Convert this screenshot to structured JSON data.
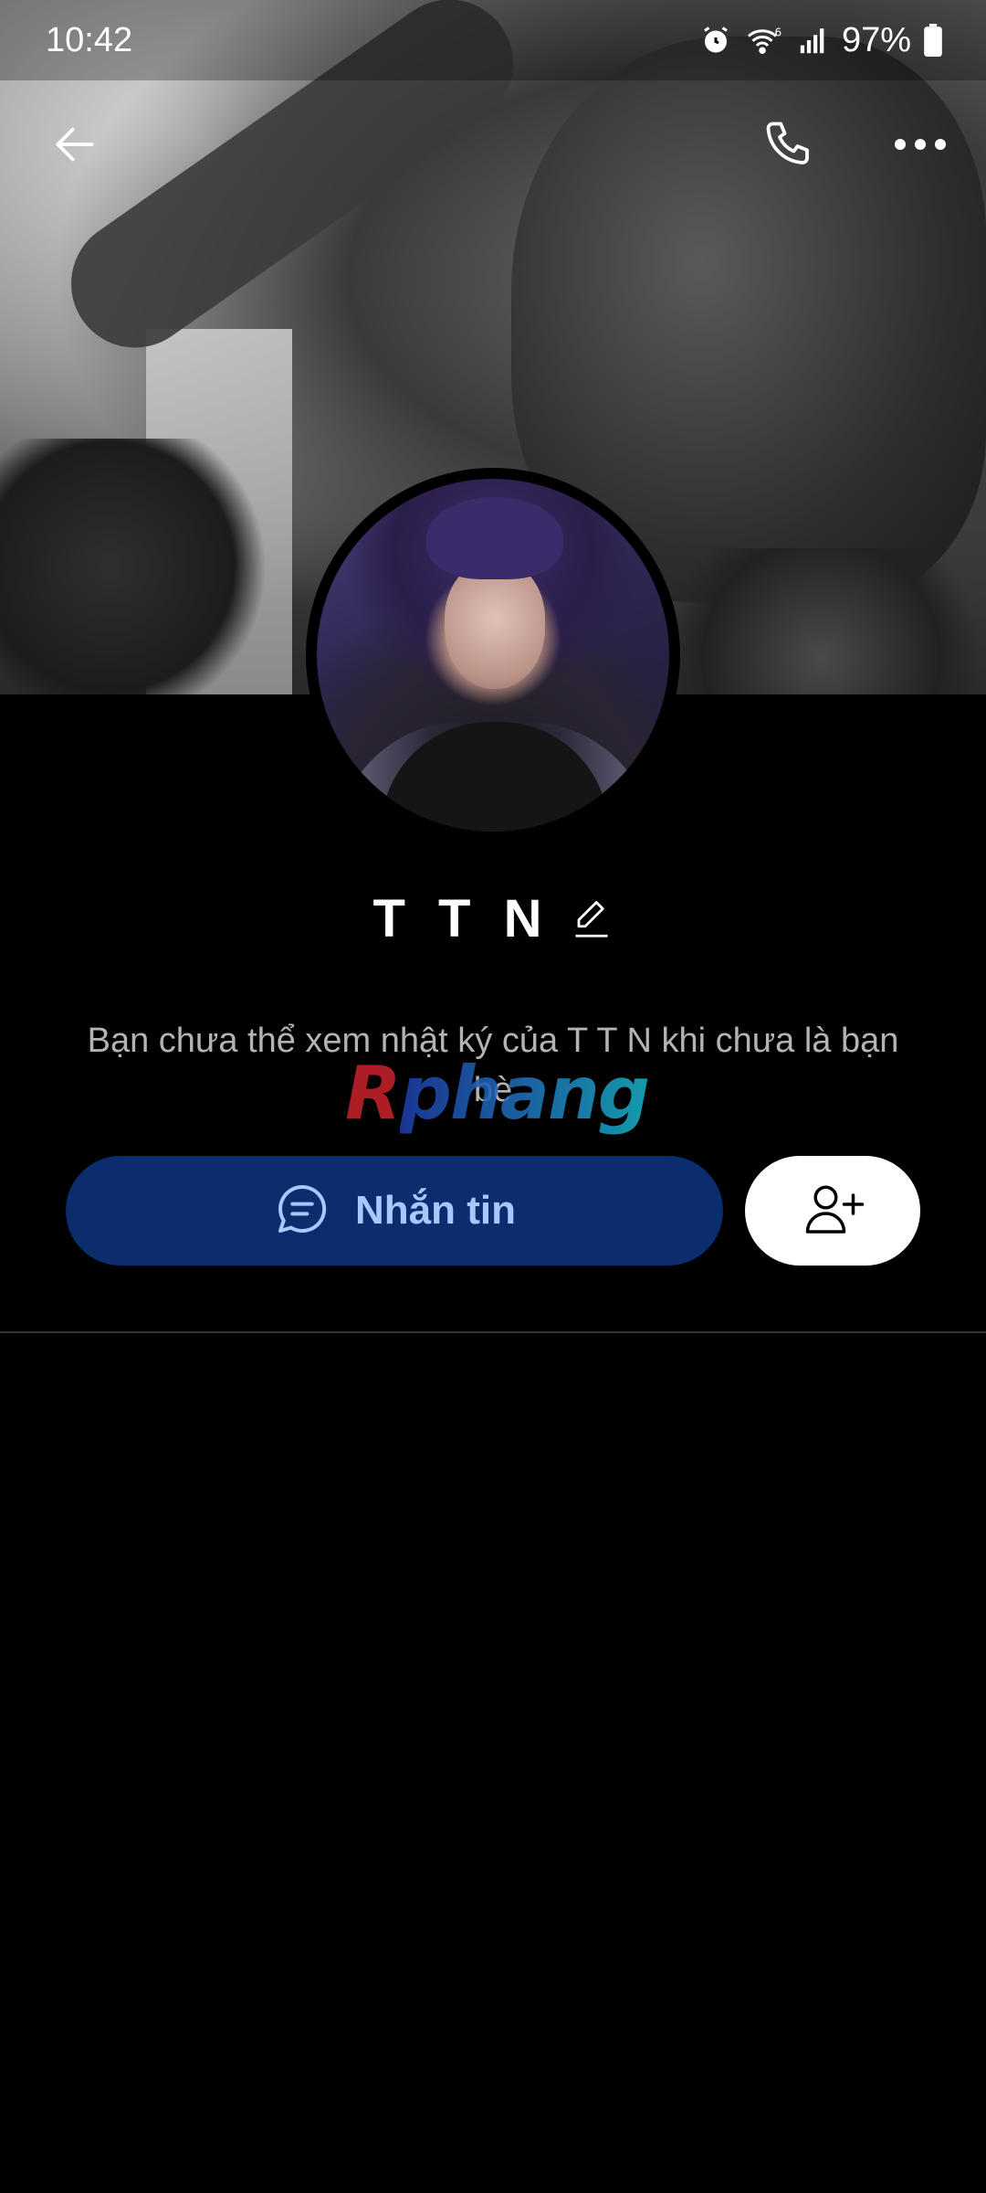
{
  "status_bar": {
    "time": "10:42",
    "battery_percent": "97%",
    "icons": [
      "alarm-icon",
      "wifi-6-icon",
      "signal-icon",
      "battery-icon"
    ]
  },
  "toolbar": {
    "icons": [
      "back-arrow-icon",
      "phone-icon",
      "more-options-icon"
    ]
  },
  "profile": {
    "name": "T T N",
    "edit_icon": "pencil-icon"
  },
  "info": {
    "message": "Bạn chưa thể xem nhật ký của T T N khi chưa là bạn bè"
  },
  "watermark": {
    "first_letter": "R",
    "rest": "phang"
  },
  "actions": {
    "message_label": "Nhắn tin",
    "message_icon": "chat-bubble-icon",
    "add_friend_icon": "add-user-icon"
  },
  "colors": {
    "background": "#000000",
    "message_button_bg": "#0a2d6e",
    "message_button_text": "#a9c8ff",
    "add_button_bg": "#ffffff",
    "info_text": "#b3b3b3",
    "divider": "#333333"
  }
}
